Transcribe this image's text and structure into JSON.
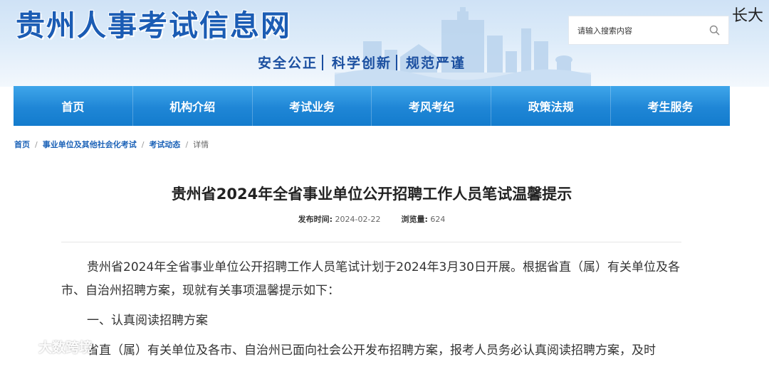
{
  "header": {
    "site_title": "贵州人事考试信息网",
    "slogan": [
      "安全公正",
      "科学创新",
      "规范严谨"
    ],
    "search_placeholder": "请输入搜索内容",
    "corner_text": "长大"
  },
  "nav": {
    "items": [
      {
        "label": "首页"
      },
      {
        "label": "机构介绍"
      },
      {
        "label": "考试业务"
      },
      {
        "label": "考风考纪"
      },
      {
        "label": "政策法规"
      },
      {
        "label": "考生服务"
      }
    ]
  },
  "breadcrumb": {
    "items": [
      "首页",
      "事业单位及其他社会化考试",
      "考试动态"
    ],
    "current": "详情",
    "separator": "/"
  },
  "article": {
    "title": "贵州省2024年全省事业单位公开招聘工作人员笔试温馨提示",
    "publish_label": "发布时间:",
    "publish_date": "2024-02-22",
    "views_label": "浏览量:",
    "views": "624",
    "paragraphs": [
      "贵州省2024年全省事业单位公开招聘工作人员笔试计划于2024年3月30日开展。根据省直（属）有关单位及各市、自治州招聘方案，现就有关事项温馨提示如下：",
      "一、认真阅读招聘方案",
      "省直（属）有关单位及各市、自治州已面向社会公开发布招聘方案，报考人员务必认真阅读招聘方案，及时"
    ]
  },
  "watermark": {
    "text": "大数跨境"
  },
  "colors": {
    "nav_blue": "#1f86d6",
    "title_blue": "#1b5cb4",
    "link_blue": "#1d63b8"
  }
}
